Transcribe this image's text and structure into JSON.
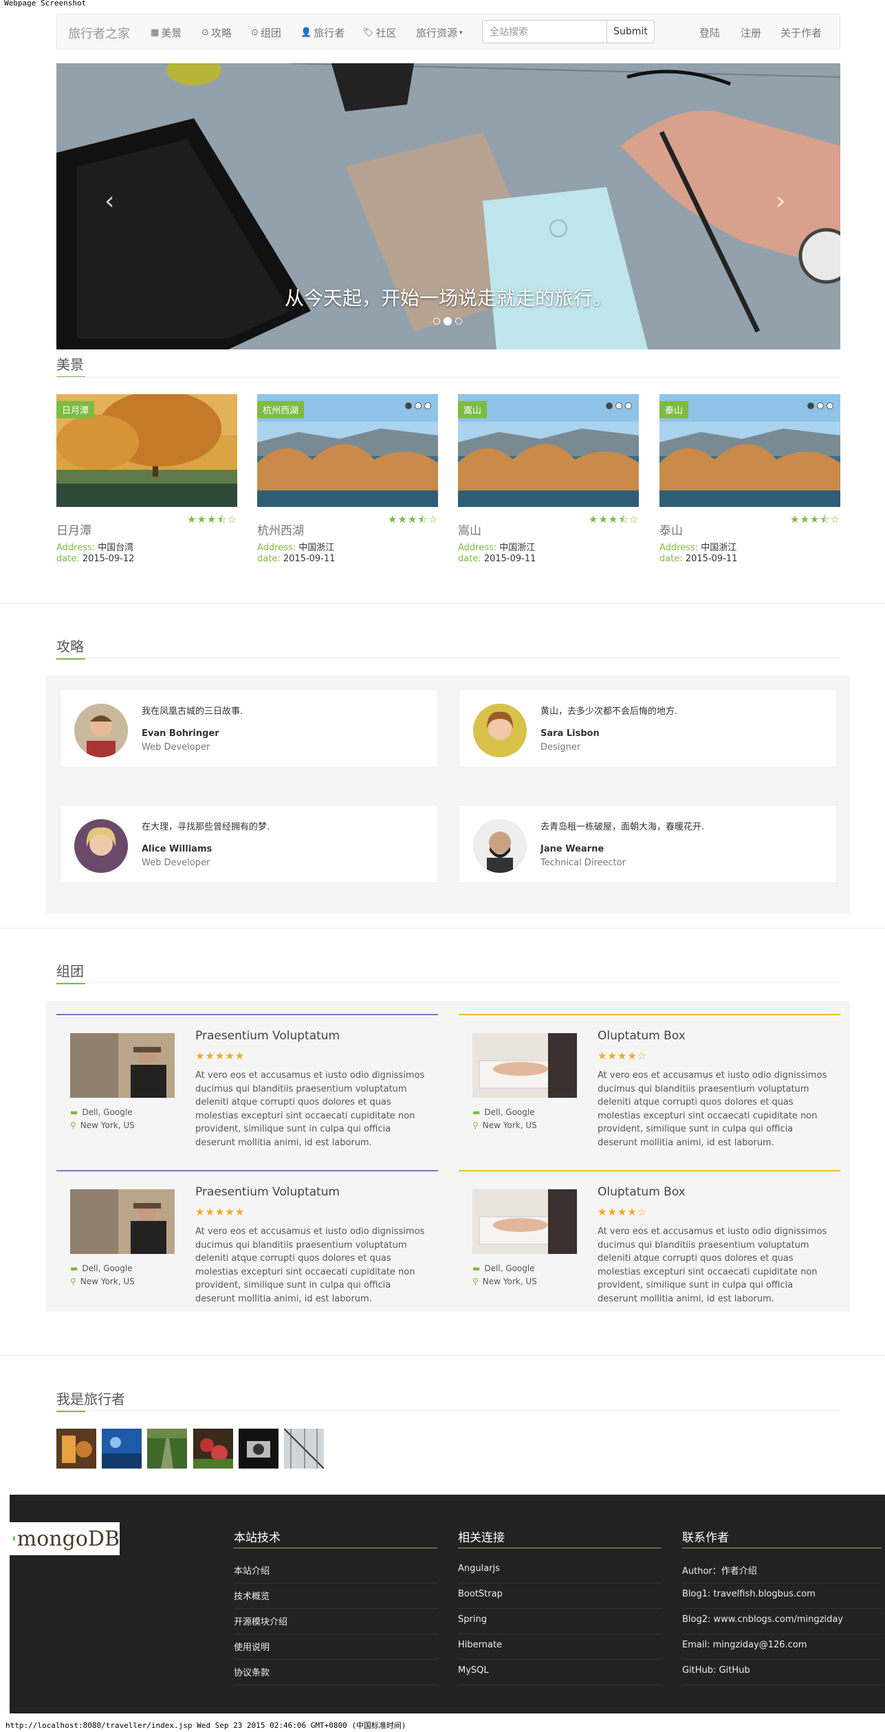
{
  "browser": {
    "header_label": "Webpage Screenshot",
    "footer_status": "http://localhost:8080/traveller/index.jsp Wed Sep 23 2015 02:46:06 GMT+0800 (中国标准时间)"
  },
  "navbar": {
    "brand": "旅行者之家",
    "items": [
      {
        "label": "美景",
        "icon": "grid-icon"
      },
      {
        "label": "攻略",
        "icon": "record-icon"
      },
      {
        "label": "组团",
        "icon": "record-icon"
      },
      {
        "label": "旅行者",
        "icon": "user-icon"
      },
      {
        "label": "社区",
        "icon": "tags-icon"
      },
      {
        "label": "旅行资源",
        "icon": "caret-down-icon"
      }
    ],
    "search_placeholder": "全站搜索",
    "submit_label": "Submit",
    "right_links": [
      "登陆",
      "注册",
      "关于作者"
    ]
  },
  "carousel": {
    "caption": "从今天起，开始一场说走就走的旅行。",
    "prev_icon": "‹",
    "next_icon": "›",
    "active_index": 1,
    "slide_count": 3
  },
  "sections": {
    "scenery": "美景",
    "guides": "攻略",
    "groups": "组团",
    "travelers": "我是旅行者"
  },
  "scenery_cards": [
    {
      "tag": "日月潭",
      "name": "日月潭",
      "stars": "★★★⯪☆",
      "address_label": "Address:",
      "address": "中国台湾",
      "date_label": "date:",
      "date": "2015-09-12",
      "dots": false
    },
    {
      "tag": "杭州西湖",
      "name": "杭州西湖",
      "stars": "★★★⯪☆",
      "address_label": "Address:",
      "address": "中国浙江",
      "date_label": "date:",
      "date": "2015-09-11",
      "dots": true
    },
    {
      "tag": "嵩山",
      "name": "嵩山",
      "stars": "★★★⯪☆",
      "address_label": "Address:",
      "address": "中国浙江",
      "date_label": "date:",
      "date": "2015-09-11",
      "dots": true
    },
    {
      "tag": "泰山",
      "name": "泰山",
      "stars": "★★★⯪☆",
      "address_label": "Address:",
      "address": "中国浙江",
      "date_label": "date:",
      "date": "2015-09-11",
      "dots": true
    }
  ],
  "testimonials": [
    {
      "quote": "我在凤凰古城的三日故事.",
      "name": "Evan Bohringer",
      "role": "Web Developer"
    },
    {
      "quote": "黄山，去多少次都不会后悔的地方.",
      "name": "Sara Lisbon",
      "role": "Designer"
    },
    {
      "quote": "在大理，寻找那些曾经拥有的梦.",
      "name": "Alice Williams",
      "role": "Web Developer"
    },
    {
      "quote": "去青岛租一栋破屋，面朝大海，春暖花开.",
      "name": "Jane Wearne",
      "role": "Technical Direector"
    }
  ],
  "groups": [
    {
      "title": "Praesentium Voluptatum",
      "stars": "★★★★★",
      "company": "Dell, Google",
      "location": "New York, US",
      "desc": "At vero eos et accusamus et iusto odio dignissimos ducimus qui blanditiis praesentium voluptatum deleniti atque corrupti quos dolores et quas molestias excepturi sint occaecati cupiditate non provident, similique sunt in culpa qui officia deserunt mollitia animi, id est laborum.",
      "accent": "#8e6fc9"
    },
    {
      "title": "Oluptatum Box",
      "stars": "★★★★☆",
      "company": "Dell, Google",
      "location": "New York, US",
      "desc": "At vero eos et accusamus et iusto odio dignissimos ducimus qui blanditiis praesentium voluptatum deleniti atque corrupti quos dolores et quas molestias excepturi sint occaecati cupiditate non provident, similique sunt in culpa qui officia deserunt mollitia animi, id est laborum.",
      "accent": "#f0c419"
    },
    {
      "title": "Praesentium Voluptatum",
      "stars": "★★★★★",
      "company": "Dell, Google",
      "location": "New York, US",
      "desc": "At vero eos et accusamus et iusto odio dignissimos ducimus qui blanditiis praesentium voluptatum deleniti atque corrupti quos dolores et quas molestias excepturi sint occaecati cupiditate non provident, similique sunt in culpa qui officia deserunt mollitia animi, id est laborum.",
      "accent": "#8e6fc9"
    },
    {
      "title": "Oluptatum Box",
      "stars": "★★★★☆",
      "company": "Dell, Google",
      "location": "New York, US",
      "desc": "At vero eos et accusamus et iusto odio dignissimos ducimus qui blanditiis praesentium voluptatum deleniti atque corrupti quos dolores et quas molestias excepturi sint occaecati cupiditate non provident, similique sunt in culpa qui officia deserunt mollitia animi, id est laborum.",
      "accent": "#f0c419"
    }
  ],
  "traveler_thumbs": 6,
  "footer": {
    "logo_text": "mongoDB",
    "columns": [
      {
        "title": "本站技术",
        "items": [
          "本站介绍",
          "技术概览",
          "开源模块介绍",
          "使用说明",
          "协议条款"
        ]
      },
      {
        "title": "相关连接",
        "items": [
          "Angularjs",
          "BootStrap",
          "Spring",
          "Hibernate",
          "MySQL"
        ]
      },
      {
        "title": "联系作者",
        "items": [
          "Author：作者介绍",
          "Blog1: travelfish.blogbus.com",
          "Blog2: www.cnblogs.com/mingziday",
          "Email: mingziday@126.com",
          "GitHub: GitHub"
        ]
      }
    ]
  },
  "colors": {
    "accent": "#7dbb43",
    "footer_bg": "#222222",
    "group_purple": "#8e6fc9",
    "group_yellow": "#f0c419"
  }
}
